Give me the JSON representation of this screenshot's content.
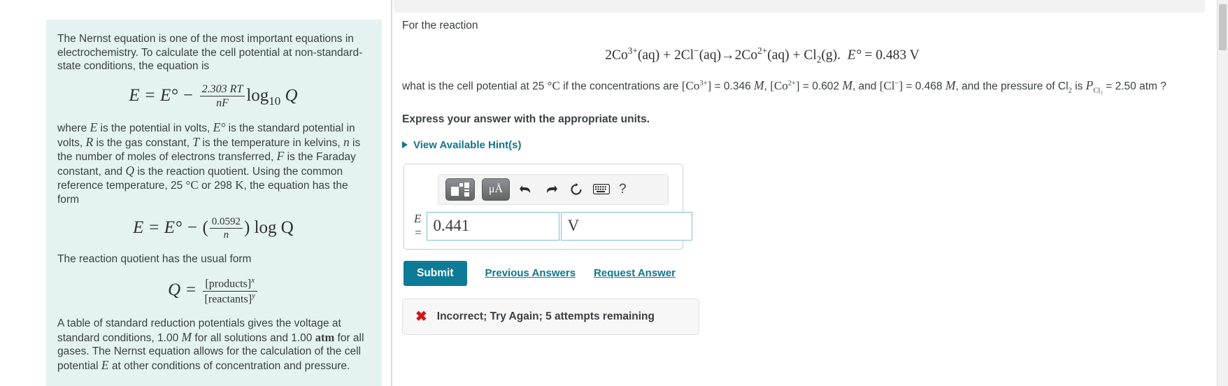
{
  "left": {
    "para1": "The Nernst equation is one of the most important equations in electrochemistry. To calculate the cell potential at non-standard-state conditions, the equation is",
    "equation1": {
      "lhs": "E = E° −",
      "frac_num": "2.303 RT",
      "frac_den": "nF",
      "log": "log",
      "log_sub": "10",
      "q": "Q"
    },
    "para2_parts": {
      "a": "where ",
      "v_E": "E",
      "b": " is the potential in volts, ",
      "v_E0": "E°",
      "c": " is the standard potential in volts, ",
      "v_R": "R",
      "d": " is the gas constant, ",
      "v_T": "T",
      "e": " is the temperature in kelvins, ",
      "v_n": "n",
      "f": " is the number of moles of electrons transferred, ",
      "v_F": "F",
      "g": " is the Faraday constant, and ",
      "v_Q": "Q",
      "h": " is the reaction quotient. Using the common reference temperature, 25 ",
      "deg_c": "°C",
      "i": " or 298 ",
      "kelvin": "K",
      "j": ", the equation has the form"
    },
    "equation2": {
      "lhs": "E = E° −",
      "frac_num": "0.0592",
      "frac_den": "n",
      "rhs": "log Q"
    },
    "para3": "The reaction quotient has the usual form",
    "equation3": {
      "lhs": "Q =",
      "num": "[products]",
      "num_sup": "x",
      "den": "[reactants]",
      "den_sup": "y"
    },
    "para4_parts": {
      "a": "A table of standard reduction potentials gives the voltage at standard conditions, 1.00 ",
      "molar": "M",
      "b": " for all solutions and 1.00 ",
      "atm": "atm",
      "c": " for all gases. The Nernst equation allows for the calculation of the cell potential ",
      "v_E": "E",
      "d": " at other conditions of concentration and pressure."
    }
  },
  "right": {
    "intro": "For the reaction",
    "reaction": {
      "r1": "2Co",
      "r1_sup": "3+",
      "r1_state": "(aq) + 2Cl",
      "r2_sup": "−",
      "r2_state": "(aq)→2Co",
      "r3_sup": "2+",
      "r3_state": "(aq) + Cl",
      "r4_sub": "2",
      "r4_state": "(g).",
      "e_label": "E°",
      "e_value": "= 0.483 V"
    },
    "question": {
      "q1": "what is the cell potential at 25 ",
      "degc": "°C",
      "q2": " if the concentrations are ",
      "co3": "[Co",
      "co3_sup": "3+",
      "co3_close": "]",
      "co3_val": "= 0.346 ",
      "m1": "M",
      "q3": ", ",
      "co2": "[Co",
      "co2_sup": "2+",
      "co2_close": "]",
      "co2_val": "= 0.602 ",
      "m2": "M",
      "q4": ", and ",
      "cl": "[Cl",
      "cl_sup": "−",
      "cl_close": "]",
      "cl_val": "= 0.468 ",
      "m3": "M",
      "q5": ", and the pressure of Cl",
      "cl_sub": "2",
      "q6": " is ",
      "p_label": "P",
      "p_sub": "Cl₂",
      "p_val": "= 2.50 atm ?"
    },
    "express": "Express your answer with the appropriate units.",
    "hint_label": "View Available Hint(s)",
    "toolbar": {
      "template_icon": "math-template-icon",
      "units_icon": "μÅ",
      "undo_icon": "undo-icon",
      "redo_icon": "redo-icon",
      "reset_icon": "reset-icon",
      "keyboard_icon": "keyboard-icon",
      "help_icon": "?"
    },
    "answer": {
      "label": "E =",
      "value": "0.441",
      "unit_value": "V",
      "placeholder": "",
      "unit_placeholder": ""
    },
    "submit_label": "Submit",
    "previous_answers_label": "Previous Answers",
    "request_answer_label": "Request Answer",
    "feedback": {
      "icon": "✖",
      "text": "Incorrect; Try Again; 5 attempts remaining"
    }
  },
  "colors": {
    "accent": "#0e7b96",
    "link": "#10768c",
    "panel_bg": "#e4f3f2",
    "error": "#cc1a1a",
    "input_border": "#7fc2d4"
  }
}
